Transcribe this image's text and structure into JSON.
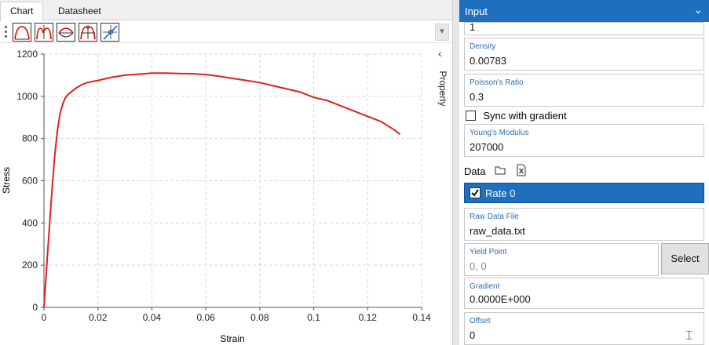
{
  "tabs": [
    {
      "label": "Chart",
      "active": true
    },
    {
      "label": "Datasheet",
      "active": false
    }
  ],
  "toolbar": {
    "buttons": [
      "chart-style-1-icon",
      "chart-style-2-icon",
      "chart-style-3-icon",
      "chart-style-4-icon",
      "chart-cursor-icon"
    ]
  },
  "side_panel": {
    "label": "Property"
  },
  "input_panel": {
    "title": "Input",
    "top_value": "1",
    "density": {
      "label": "Density",
      "value": "0.00783"
    },
    "poisson": {
      "label": "Poisson's Ratio",
      "value": "0.3"
    },
    "sync": {
      "label": "Sync with gradient",
      "checked": false
    },
    "youngs": {
      "label": "Young's Modulus",
      "value": "207000"
    },
    "data": {
      "label": "Data"
    },
    "rate": {
      "label": "Rate 0",
      "checked": true
    },
    "raw_data": {
      "label": "Raw Data File",
      "value": "raw_data.txt"
    },
    "yield": {
      "label": "Yield Point",
      "placeholder": "0, 0"
    },
    "select_label": "Select",
    "gradient": {
      "label": "Gradient",
      "value": "0.0000E+000"
    },
    "offset": {
      "label": "Offset",
      "value": "0"
    }
  },
  "colors": {
    "accent": "#1f6fbf",
    "series": "#e02020"
  },
  "chart_data": {
    "type": "line",
    "xlabel": "Strain",
    "ylabel": "Stress",
    "xlim": [
      0,
      0.14
    ],
    "ylim": [
      0,
      1200
    ],
    "xticks": [
      "0",
      "0.02",
      "0.04",
      "0.06",
      "0.08",
      "0.1",
      "0.12",
      "0.14"
    ],
    "yticks": [
      "0",
      "200",
      "400",
      "600",
      "800",
      "1000",
      "1200"
    ],
    "grid": true,
    "series": [
      {
        "x": [
          0,
          0.001,
          0.002,
          0.003,
          0.004,
          0.005,
          0.006,
          0.007,
          0.008,
          0.009,
          0.01,
          0.012,
          0.014,
          0.016,
          0.018,
          0.02,
          0.025,
          0.03,
          0.035,
          0.04,
          0.045,
          0.05,
          0.055,
          0.06,
          0.065,
          0.07,
          0.075,
          0.08,
          0.085,
          0.09,
          0.095,
          0.1,
          0.105,
          0.11,
          0.115,
          0.12,
          0.125,
          0.13,
          0.132
        ],
        "y": [
          0,
          190,
          380,
          560,
          720,
          840,
          920,
          965,
          995,
          1010,
          1020,
          1040,
          1055,
          1065,
          1070,
          1075,
          1090,
          1100,
          1105,
          1110,
          1110,
          1108,
          1107,
          1103,
          1095,
          1085,
          1075,
          1065,
          1050,
          1035,
          1020,
          995,
          980,
          955,
          930,
          905,
          880,
          840,
          820
        ]
      }
    ]
  }
}
